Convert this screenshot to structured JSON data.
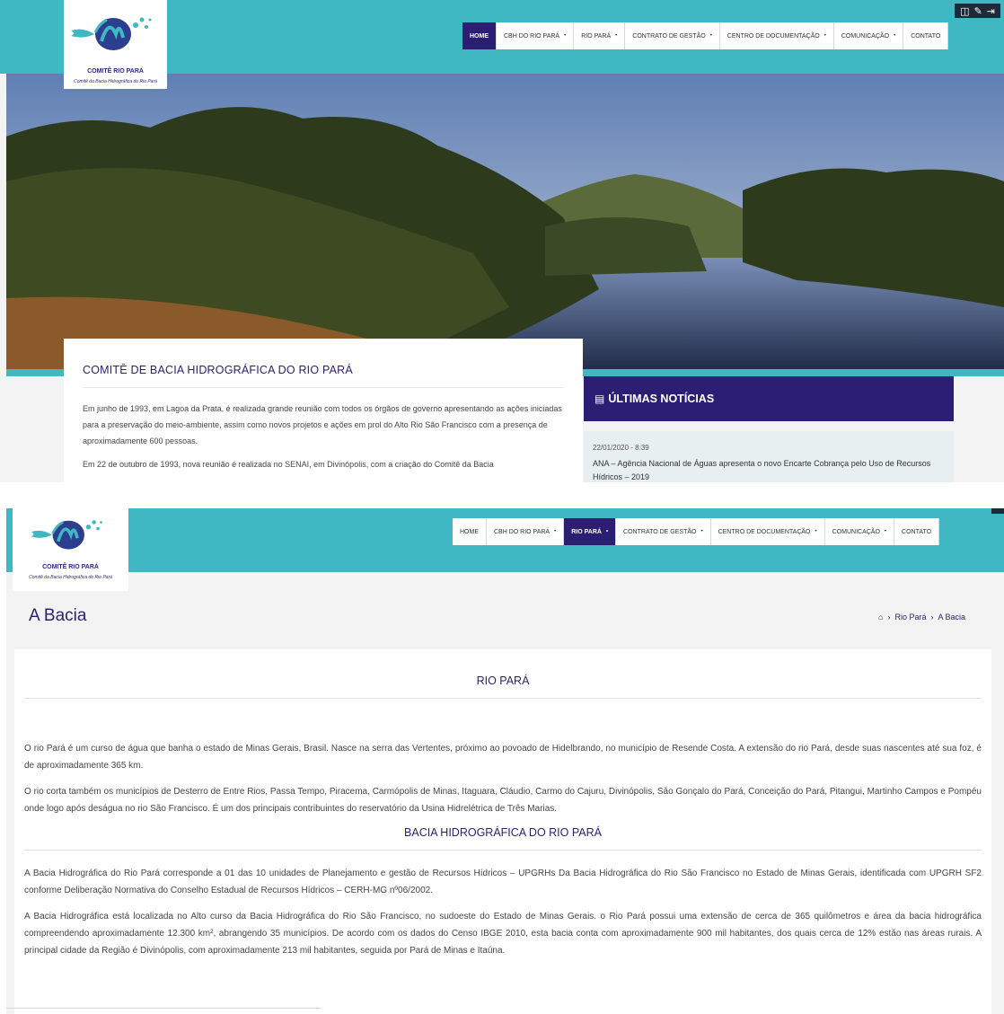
{
  "logo": {
    "title": "COMITÊ RIO PARÁ",
    "subtitle": "Comitê da Bacia Hidrográfica do Rio Pará"
  },
  "toolbar": {
    "icons": [
      "layout-icon",
      "edit-icon",
      "logout-icon"
    ]
  },
  "shot1": {
    "nav": [
      {
        "label": "HOME",
        "active": true,
        "dropdown": false
      },
      {
        "label": "CBH DO RIO PARÁ",
        "active": false,
        "dropdown": true
      },
      {
        "label": "RIO PARÁ",
        "active": false,
        "dropdown": true
      },
      {
        "label": "CONTRATO DE GESTÃO",
        "active": false,
        "dropdown": true
      },
      {
        "label": "CENTRO DE DOCUMENTAÇÃO",
        "active": false,
        "dropdown": true
      },
      {
        "label": "COMUNICAÇÃO",
        "active": false,
        "dropdown": true
      },
      {
        "label": "CONTATO",
        "active": false,
        "dropdown": false
      }
    ],
    "intro": {
      "heading": "COMITÊ DE BACIA HIDROGRÁFICA DO RIO PARÁ",
      "p1": "Em junho de 1993, em Lagoa da Prata, é realizada grande reunião com todos os órgãos de governo apresentando as ações iniciadas para a preservação do meio-ambiente, assim como novos projetos e ações em prol do Alto Rio São Francisco com a presença de aproximadamente 600 pessoas.",
      "p2": "Em 22 de outubro de 1993, nova reunião é realizada no SENAI, em Divinópolis, com a criação do Comitê da Bacia"
    },
    "news": {
      "heading": "ÚLTIMAS NOTÍCIAS",
      "date": "22/01/2020 - 8:39",
      "text": "ANA – Agência Nacional de Águas apresenta o novo Encarte  Cobrança pelo Uso de Recursos Hídricos – 2019"
    }
  },
  "shot2": {
    "nav": [
      {
        "label": "HOME",
        "active": false,
        "dropdown": false
      },
      {
        "label": "CBH DO RIO PARÁ",
        "active": false,
        "dropdown": true
      },
      {
        "label": "RIO PARÁ",
        "active": true,
        "dropdown": true
      },
      {
        "label": "CONTRATO DE GESTÃO",
        "active": false,
        "dropdown": true
      },
      {
        "label": "CENTRO DE DOCUMENTAÇÃO",
        "active": false,
        "dropdown": true
      },
      {
        "label": "COMUNICAÇÃO",
        "active": false,
        "dropdown": true
      },
      {
        "label": "CONTATO",
        "active": false,
        "dropdown": false
      }
    ],
    "page_title": "A Bacia",
    "breadcrumb": [
      "Rio Pará",
      "A Bacia"
    ],
    "section1_heading": "RIO PARÁ",
    "p1": "O rio Pará é um curso de água que banha o estado de Minas Gerais, Brasil. Nasce na serra das Vertentes, próximo ao povoado de Hidelbrando, no município de Resende Costa. A extensão do rio Pará, desde suas nascentes até sua foz, é de aproximadamente 365 km.",
    "p2": "O rio corta também os municípios de Desterro de Entre Rios, Passa Tempo, Piracema, Carmópolis de Minas, Itaguara, Cláudio, Carmo do Cajuru, Divinópolis, São Gonçalo do Pará, Conceição do Pará, Pitangui, Martinho Campos e Pompéu onde logo após deságua no rio São Francisco. É um dos principais contribuintes do reservatório da Usina Hidrelétrica de Três Marias.",
    "section2_heading": "BACIA HIDROGRÁFICA DO RIO PARÁ",
    "p3": "A Bacia Hidrográfica do Rio Pará corresponde a 01 das 10 unidades de Planejamento e gestão de Recursos Hídricos  – UPGRHs Da Bacia Hidrográfica do Rio São Francisco no Estado de Minas Gerais, identificada com UPGRH SF2 conforme Deliberação Normativa do Conselho Estadual de Recursos Hídricos – CERH-MG nº06/2002.",
    "p4": "A Bacia Hidrográfica está localizada no Alto curso da Bacia Hidrográfica do Rio São Francisco, no sudoeste do Estado de Minas Gerais. o Rio Pará possui uma extensão de cerca de 365 quilômetros e área da bacia hidrográfica compreendendo aproximadamente 12.300 km², abrangendo 35 municípios. De acordo com os dados do Censo IBGE 2010, esta bacia conta com aproximadamente 900 mil habitantes, dos quais cerca de 12% estão nas áreas rurais. A principal cidade da Região é Divinópolis, com aproximadamente 213 mil habitantes, seguida por Pará de Minas e Itaúna."
  }
}
